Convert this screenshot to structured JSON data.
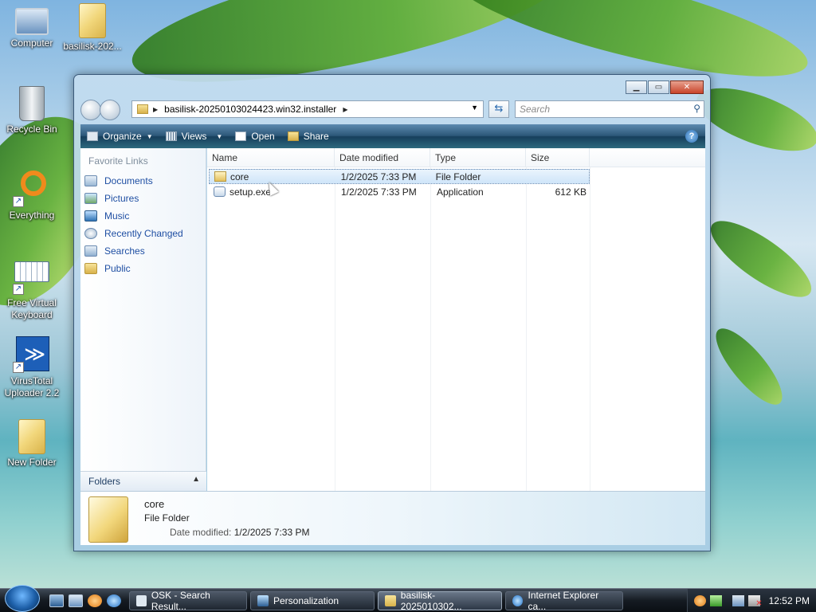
{
  "desktop": {
    "icons": [
      {
        "label": "Computer",
        "icon": "computer-icon"
      },
      {
        "label": "basilisk-202...",
        "icon": "folder-icon"
      },
      {
        "label": "Recycle Bin",
        "icon": "recycle-bin-icon"
      },
      {
        "label": "Everything",
        "icon": "everything-search-icon"
      },
      {
        "label": "Free Virtual Keyboard",
        "icon": "keyboard-icon"
      },
      {
        "label": "VirusTotal Uploader 2.2",
        "icon": "virustotal-icon"
      },
      {
        "label": "New Folder",
        "icon": "folder-icon"
      }
    ]
  },
  "window": {
    "address": {
      "segments": [
        "basilisk-20250103024423.win32.installer"
      ]
    },
    "search": {
      "placeholder": "Search"
    },
    "toolbar": {
      "organize": "Organize",
      "views": "Views",
      "open": "Open",
      "share": "Share"
    },
    "favorites": {
      "title": "Favorite Links",
      "items": [
        "Documents",
        "Pictures",
        "Music",
        "Recently Changed",
        "Searches",
        "Public"
      ]
    },
    "folders_label": "Folders",
    "columns": {
      "name": "Name",
      "date": "Date modified",
      "type": "Type",
      "size": "Size"
    },
    "files": [
      {
        "name": "core",
        "date": "1/2/2025 7:33 PM",
        "type": "File Folder",
        "size": "",
        "selected": true
      },
      {
        "name": "setup.exe",
        "date": "1/2/2025 7:33 PM",
        "type": "Application",
        "size": "612 KB",
        "selected": false
      }
    ],
    "details": {
      "name": "core",
      "type": "File Folder",
      "modified_label": "Date modified:",
      "modified_value": "1/2/2025 7:33 PM"
    }
  },
  "taskbar": {
    "tasks": [
      "OSK - Search Result...",
      "Personalization",
      "basilisk-2025010302...",
      "Internet Explorer ca..."
    ],
    "active_task": 2,
    "clock": "12:52 PM"
  },
  "colors": {
    "accent": "#1f4fa3",
    "toolbar": "#2c5778"
  }
}
